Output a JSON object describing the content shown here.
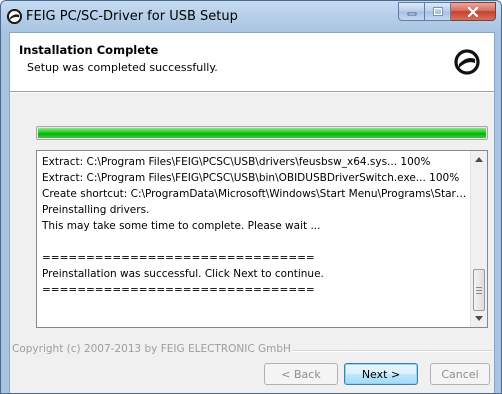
{
  "window": {
    "title": "FEIG PC/SC-Driver for USB Setup"
  },
  "header": {
    "title": "Installation Complete",
    "subtitle": "Setup was completed successfully."
  },
  "progress": {
    "percent": 100,
    "color": "#06b006"
  },
  "log": {
    "lines": [
      "Extract: C:\\Program Files\\FEIG\\PCSC\\USB\\drivers\\feusbsw_x64.sys... 100%",
      "Extract: C:\\Program Files\\FEIG\\PCSC\\USB\\bin\\OBIDUSBDriverSwitch.exe... 100%",
      "Create shortcut: C:\\ProgramData\\Microsoft\\Windows\\Start Menu\\Programs\\Startup\\...",
      "Preinstalling drivers.",
      "This may take some time to complete. Please wait ...",
      "",
      "===============================",
      "Preinstallation was successful. Click Next to continue.",
      "==============================="
    ]
  },
  "footer": {
    "branding": "Copyright (c) 2007-2013 by FEIG ELECTRONIC GmbH",
    "back_label": "< Back",
    "next_label": "Next >",
    "cancel_label": "Cancel"
  }
}
